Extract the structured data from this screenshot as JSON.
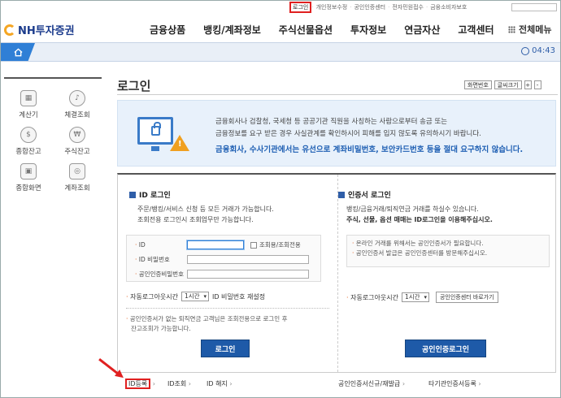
{
  "util": {
    "login": "로그인",
    "items": [
      "개인정보수정",
      "공인인증센터",
      "전자민원접수",
      "금융소비자보호"
    ]
  },
  "logo": {
    "text": "NH투자증권"
  },
  "gnb": [
    "금융상품",
    "뱅킹/계좌정보",
    "주식선물옵션",
    "투자정보",
    "연금자산",
    "고객센터"
  ],
  "allmenu": "전체메뉴",
  "clock": "04:43",
  "quick": [
    {
      "label": "계산기",
      "icon": "calculator-icon"
    },
    {
      "label": "체결조회",
      "icon": "bell-icon"
    },
    {
      "label": "종합잔고",
      "icon": "moneybag-icon"
    },
    {
      "label": "주식잔고",
      "icon": "won-coin-icon"
    },
    {
      "label": "종합화면",
      "icon": "image-icon"
    },
    {
      "label": "계좌조회",
      "icon": "search-account-icon"
    }
  ],
  "page": {
    "title": "로그인",
    "screen_no": "화면번호",
    "font_size": "글씨크기",
    "plus": "+",
    "minus": "-"
  },
  "notice": {
    "line1": "금융회사나 검찰청, 국세청 등 공공기관 직원을 사칭하는 사람으로부터 송금 또는",
    "line2": "금융정보를 요구 받은 경우 사실관계를 확인하시어 피해를 입지 않도록 유의하시기 바랍니다.",
    "line3": "금융회사, 수사기관에서는 유선으로 계좌비밀번호, 보안카드번호 등을 절대 요구하지 않습니다."
  },
  "idlogin": {
    "title": "ID 로그인",
    "desc1": "주문/뱅킹/서비스 신청 등 모든 거래가 가능합니다.",
    "desc2": "조회전용 로그인시 조회업무만 가능합니다.",
    "id_label": "ID",
    "readonly_label": "조회용/조회전용",
    "pw_label": "ID 비밀번호",
    "cert_pw_label": "공인인증비밀번호",
    "autologout_label": "자동로그아웃시간",
    "autologout_value": "1시간",
    "pw_reset": "ID 비밀번호 재설정",
    "note1": "공인인증서가 없는 퇴직연금 고객님은 조회전용으로 로그인 후",
    "note2": "잔고조회가 가능합니다.",
    "button": "로그인"
  },
  "certlogin": {
    "title": "인증서 로그인",
    "desc1": "뱅킹/금융거래/퇴직연금 거래를 하실수 있습니다.",
    "desc2": "주식, 선물, 옵션 매매는 ID로그인을 이용해주십시오.",
    "info1": "온라인 거래를 위해서는 공인인증서가 필요합니다.",
    "info2": "공인인증서 발급은 공인인증센터를 방문해주십시오.",
    "autologout_label": "자동로그아웃시간",
    "autologout_value": "1시간",
    "cert_center": "공인인증센터 바로가기",
    "button": "공인인증로그인"
  },
  "bottom": {
    "id_register": "ID등록",
    "id_lookup": "ID조회",
    "id_cancel": "ID 해지",
    "cert_issue": "공인인증서신규/재발급",
    "other_cert": "타기관인증서등록"
  }
}
